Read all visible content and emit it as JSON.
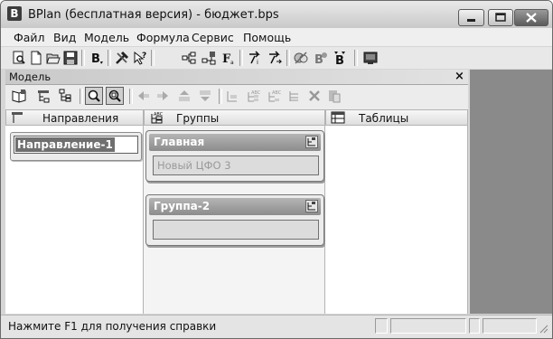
{
  "window": {
    "title": "BPlan (бесплатная версия) - бюджет.bps",
    "app_icon_letter": "B"
  },
  "menubar": {
    "items": [
      "Файл",
      "Вид",
      "Модель",
      "Формула",
      "Сервис",
      "Помощь"
    ]
  },
  "toolbar": {
    "tools": [
      "print-preview-icon",
      "new-document-icon",
      "open-folder-icon",
      "save-icon",
      "bold-b-icon",
      "tools-icon",
      "help-pointer-icon",
      "tree-structure-icon",
      "tree-settings-icon",
      "formula-f-icon",
      "connect-arrows-icon",
      "calc-arrows-icon",
      "disconnect-icon",
      "budget-icon",
      "bold-b-report-icon",
      "monitor-icon"
    ]
  },
  "model_panel": {
    "title": "Модель",
    "close_glyph": "×",
    "tools": [
      "open-book-icon",
      "add-row-icon",
      "tree-label-icon",
      "zoom-icon",
      "zoom-fit-icon",
      "move-left-icon",
      "move-right-icon",
      "move-up-icon",
      "move-down-icon",
      "label-a-icon",
      "label-b-icon",
      "label-c-icon",
      "list-icon",
      "delete-x-icon",
      "paste-icon"
    ]
  },
  "columns": {
    "directions": {
      "header": "Направления"
    },
    "groups": {
      "header": "Группы"
    },
    "tables": {
      "header": "Таблицы"
    }
  },
  "direction_cards": [
    {
      "value": "Направление-1"
    }
  ],
  "group_cards": [
    {
      "title": "Главная",
      "item": "Новый ЦФО 3"
    },
    {
      "title": "Группа-2",
      "item": ""
    }
  ],
  "statusbar": {
    "text": "Нажмите F1 для получения справки"
  }
}
